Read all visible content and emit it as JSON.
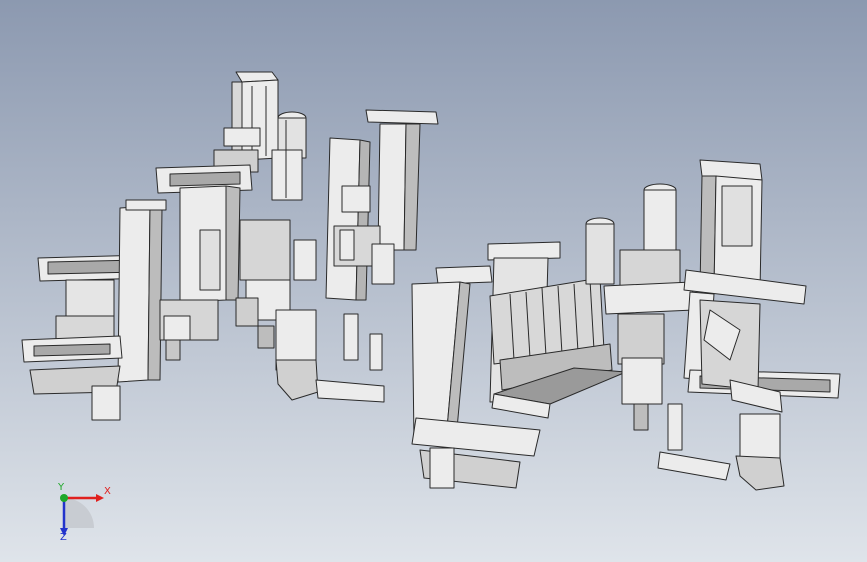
{
  "viewport": {
    "background_top": "#8c99b0",
    "background_bottom": "#dfe4ea",
    "part_fill": "#ececec",
    "part_dark": "#8f8f8f",
    "edge_color": "#2a2a2a",
    "cutout_fill": "#a9a9a9"
  },
  "triad": {
    "x_label": "X",
    "y_label": "Y",
    "z_label": "Z",
    "x_color": "#e0201e",
    "y_color": "#1fa82a",
    "z_color": "#2233cc",
    "icon": "coordinate-triad-icon"
  }
}
